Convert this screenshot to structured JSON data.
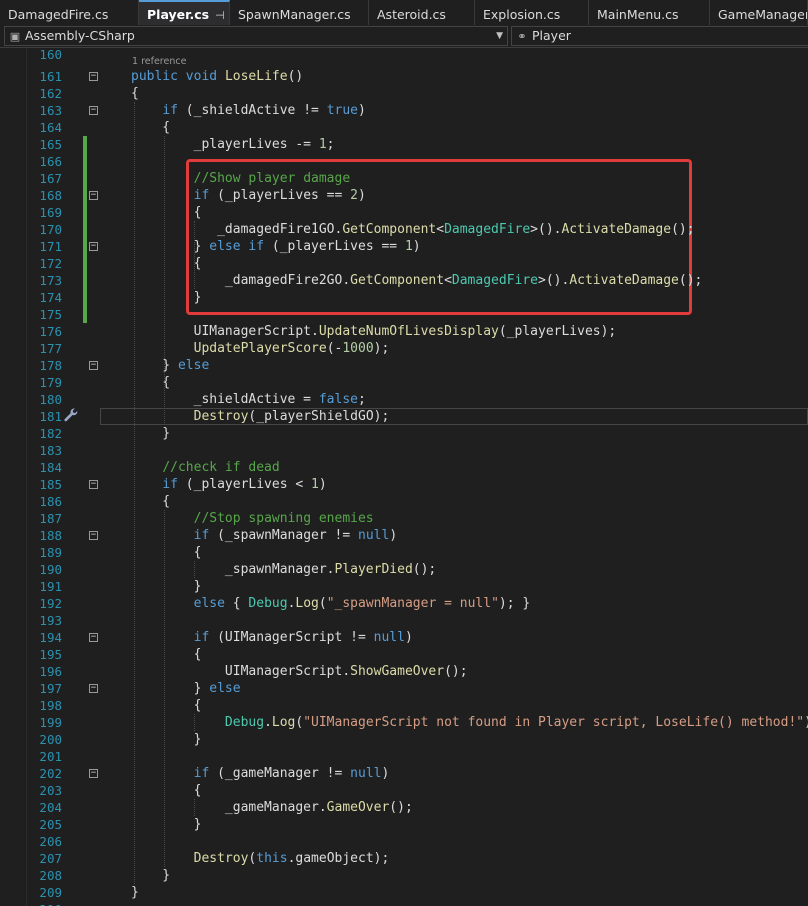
{
  "tabs": [
    {
      "label": "DamagedFire.cs",
      "active": false
    },
    {
      "label": "Player.cs",
      "active": true
    },
    {
      "label": "SpawnManager.cs",
      "active": false
    },
    {
      "label": "Asteroid.cs",
      "active": false
    },
    {
      "label": "Explosion.cs",
      "active": false
    },
    {
      "label": "MainMenu.cs",
      "active": false
    },
    {
      "label": "GameManager.cs",
      "active": false
    }
  ],
  "tab_pin_icon": "pin-icon",
  "tab_close_icon": "close-icon",
  "navbar": {
    "project": "Assembly-CSharp",
    "member": "Player"
  },
  "reference_hint": "1 reference",
  "lines": [
    {
      "n": 160,
      "html": ""
    },
    {
      "n": 161,
      "html": "<span class=\"kw\">public</span> <span class=\"kw\">void</span> <span class=\"fn\">LoseLife</span>()"
    },
    {
      "n": 162,
      "html": "{"
    },
    {
      "n": 163,
      "html": "    <span class=\"kw\">if</span> (_shieldActive != <span class=\"kw\">true</span>)"
    },
    {
      "n": 164,
      "html": "    {"
    },
    {
      "n": 165,
      "html": "        _playerLives -= <span class=\"num\">1</span>;"
    },
    {
      "n": 166,
      "html": ""
    },
    {
      "n": 167,
      "html": "        <span class=\"cm\">//Show player damage</span>"
    },
    {
      "n": 168,
      "html": "        <span class=\"kw\">if</span> (_playerLives == <span class=\"num\">2</span>)"
    },
    {
      "n": 169,
      "html": "        {"
    },
    {
      "n": 170,
      "html": "           _damagedFire1GO.<span class=\"fn\">GetComponent</span>&lt;<span class=\"tp\">DamagedFire</span>&gt;().<span class=\"fn\">ActivateDamage</span>();"
    },
    {
      "n": 171,
      "html": "        } <span class=\"kw\">else</span> <span class=\"kw\">if</span> (_playerLives == <span class=\"num\">1</span>)"
    },
    {
      "n": 172,
      "html": "        {"
    },
    {
      "n": 173,
      "html": "            _damagedFire2GO.<span class=\"fn\">GetComponent</span>&lt;<span class=\"tp\">DamagedFire</span>&gt;().<span class=\"fn\">ActivateDamage</span>();"
    },
    {
      "n": 174,
      "html": "        }"
    },
    {
      "n": 175,
      "html": ""
    },
    {
      "n": 176,
      "html": "        UIManagerScript.<span class=\"fn\">UpdateNumOfLivesDisplay</span>(_playerLives);"
    },
    {
      "n": 177,
      "html": "        <span class=\"fn\">UpdatePlayerScore</span>(-<span class=\"num\">1000</span>);"
    },
    {
      "n": 178,
      "html": "    } <span class=\"kw\">else</span>"
    },
    {
      "n": 179,
      "html": "    {"
    },
    {
      "n": 180,
      "html": "        _shieldActive = <span class=\"kw\">false</span>;"
    },
    {
      "n": 181,
      "html": "        <span class=\"fn\">Destroy</span>(_playerShieldGO);"
    },
    {
      "n": 182,
      "html": "    }"
    },
    {
      "n": 183,
      "html": ""
    },
    {
      "n": 184,
      "html": "    <span class=\"cm\">//check if dead</span>"
    },
    {
      "n": 185,
      "html": "    <span class=\"kw\">if</span> (_playerLives &lt; <span class=\"num\">1</span>)"
    },
    {
      "n": 186,
      "html": "    {"
    },
    {
      "n": 187,
      "html": "        <span class=\"cm\">//Stop spawning enemies</span>"
    },
    {
      "n": 188,
      "html": "        <span class=\"kw\">if</span> (_spawnManager != <span class=\"kw\">null</span>)"
    },
    {
      "n": 189,
      "html": "        {"
    },
    {
      "n": 190,
      "html": "            _spawnManager.<span class=\"fn\">PlayerDied</span>();"
    },
    {
      "n": 191,
      "html": "        }"
    },
    {
      "n": 192,
      "html": "        <span class=\"kw\">else</span> { <span class=\"tp\">Debug</span>.<span class=\"fn\">Log</span>(<span class=\"str\">\"_spawnManager = null\"</span>); }"
    },
    {
      "n": 193,
      "html": ""
    },
    {
      "n": 194,
      "html": "        <span class=\"kw\">if</span> (UIManagerScript != <span class=\"kw\">null</span>)"
    },
    {
      "n": 195,
      "html": "        {"
    },
    {
      "n": 196,
      "html": "            UIManagerScript.<span class=\"fn\">ShowGameOver</span>();"
    },
    {
      "n": 197,
      "html": "        } <span class=\"kw\">else</span>"
    },
    {
      "n": 198,
      "html": "        {"
    },
    {
      "n": 199,
      "html": "            <span class=\"tp\">Debug</span>.<span class=\"fn\">Log</span>(<span class=\"str\">\"UIManagerScript not found in Player script, LoseLife() method!\"</span>);"
    },
    {
      "n": 200,
      "html": "        }"
    },
    {
      "n": 201,
      "html": ""
    },
    {
      "n": 202,
      "html": "        <span class=\"kw\">if</span> (_gameManager != <span class=\"kw\">null</span>)"
    },
    {
      "n": 203,
      "html": "        {"
    },
    {
      "n": 204,
      "html": "            _gameManager.<span class=\"fn\">GameOver</span>();"
    },
    {
      "n": 205,
      "html": "        }"
    },
    {
      "n": 206,
      "html": ""
    },
    {
      "n": 207,
      "html": "        <span class=\"fn\">Destroy</span>(<span class=\"kw\">this</span>.gameObject);"
    },
    {
      "n": 208,
      "html": "    }"
    },
    {
      "n": 209,
      "html": "}"
    },
    {
      "n": 210,
      "html": ""
    }
  ],
  "fold_lines": [
    161,
    163,
    168,
    171,
    178,
    185,
    188,
    194,
    197,
    202
  ],
  "changed_lines": [
    165,
    166,
    167,
    168,
    169,
    170,
    171,
    172,
    173,
    174,
    175
  ],
  "cursor_line": 181,
  "colors": {
    "keyword": "#569cd6",
    "type": "#4ec9b0",
    "method": "#dcdcaa",
    "comment": "#57a64a",
    "string": "#d69d85",
    "number": "#b5cea8",
    "line_number": "#2b91af",
    "highlight_box": "#e23b3b"
  }
}
